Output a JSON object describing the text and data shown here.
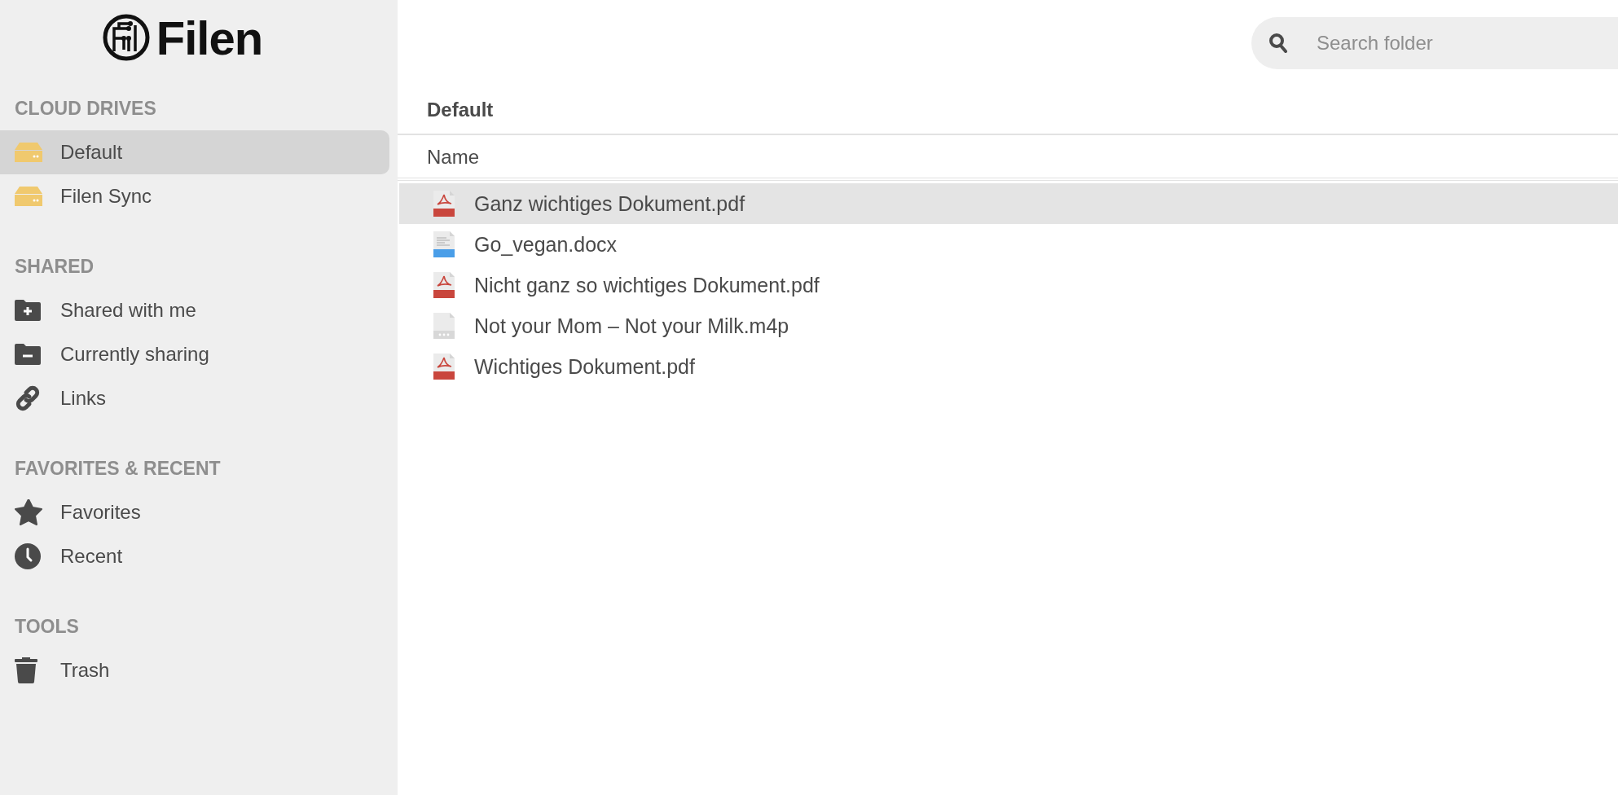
{
  "logo": {
    "text": "Filen"
  },
  "sidebar": {
    "sections": [
      {
        "heading": "CLOUD DRIVES",
        "items": [
          {
            "label": "Default",
            "kind": "drive",
            "selected": true
          },
          {
            "label": "Filen Sync",
            "kind": "drive",
            "selected": false
          }
        ]
      },
      {
        "heading": "SHARED",
        "items": [
          {
            "label": "Shared with me",
            "kind": "incoming",
            "selected": false
          },
          {
            "label": "Currently sharing",
            "kind": "outgoing",
            "selected": false
          },
          {
            "label": "Links",
            "kind": "links",
            "selected": false
          }
        ]
      },
      {
        "heading": "FAVORITES & RECENT",
        "items": [
          {
            "label": "Favorites",
            "kind": "favorites",
            "selected": false
          },
          {
            "label": "Recent",
            "kind": "recent",
            "selected": false
          }
        ]
      },
      {
        "heading": "TOOLS",
        "items": [
          {
            "label": "Trash",
            "kind": "trash",
            "selected": false
          }
        ]
      }
    ]
  },
  "search": {
    "placeholder": "Search folder"
  },
  "folder_title": "Default",
  "table": {
    "columns": [
      "Name"
    ],
    "rows": [
      {
        "name": "Ganz wichtiges Dokument.pdf",
        "kind": "pdf",
        "selected": true
      },
      {
        "name": "Go_vegan.docx",
        "kind": "doc",
        "selected": false
      },
      {
        "name": "Nicht ganz so wichtiges Dokument.pdf",
        "kind": "pdf",
        "selected": false
      },
      {
        "name": "Not your Mom – Not your Milk.m4p",
        "kind": "generic",
        "selected": false
      },
      {
        "name": "Wichtiges Dokument.pdf",
        "kind": "pdf",
        "selected": false
      }
    ]
  }
}
